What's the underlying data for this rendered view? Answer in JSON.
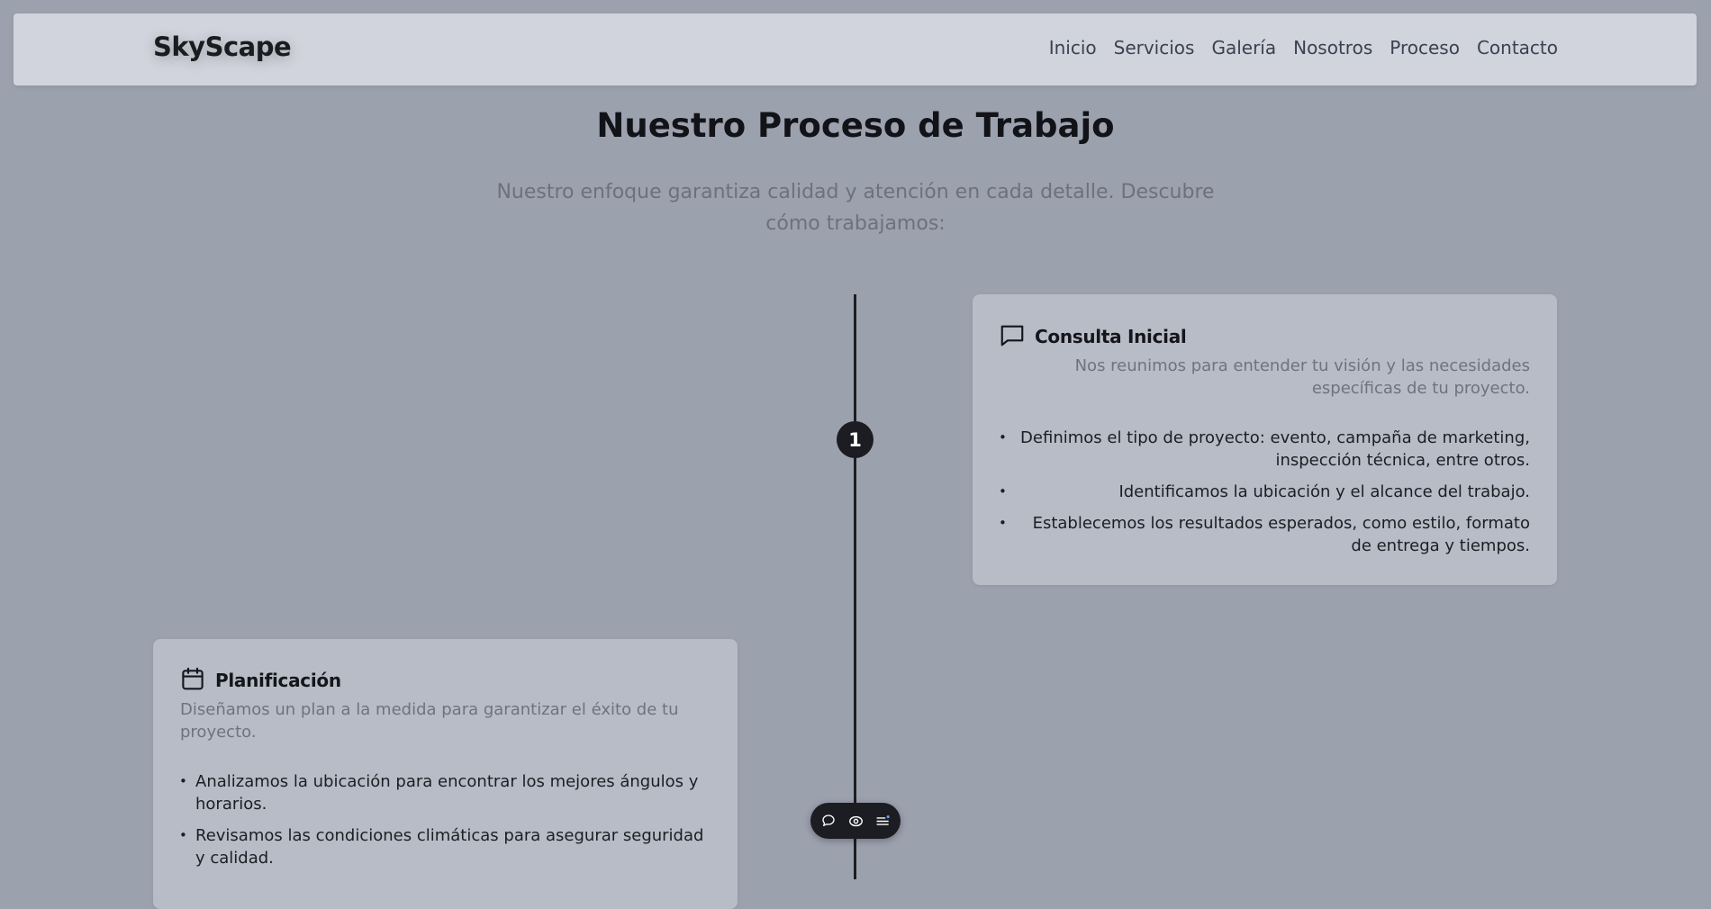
{
  "navbar": {
    "brand": "SkyScape",
    "links": [
      "Inicio",
      "Servicios",
      "Galería",
      "Nosotros",
      "Proceso",
      "Contacto"
    ]
  },
  "header": {
    "title": "Nuestro Proceso de Trabajo",
    "subtitle": "Nuestro enfoque garantiza calidad y atención en cada detalle. Descubre cómo trabajamos:"
  },
  "timeline": {
    "steps": [
      {
        "number": "1",
        "icon": "chat-bubble-icon",
        "title": "Consulta Inicial",
        "description": "Nos reunimos para entender tu visión y las necesidades específicas de tu proyecto.",
        "items": [
          "Definimos el tipo de proyecto: evento, campaña de marketing, inspección técnica, entre otros.",
          "Identificamos la ubicación y el alcance del trabajo.",
          "Establecemos los resultados esperados, como estilo, formato de entrega y tiempos."
        ]
      },
      {
        "icon": "calendar-icon",
        "title": "Planificación",
        "description": "Diseñamos un plan a la medida para garantizar el éxito de tu proyecto.",
        "items": [
          "Analizamos la ubicación para encontrar los mejores ángulos y horarios.",
          "Revisamos las condiciones climáticas para asegurar seguridad y calidad."
        ]
      }
    ]
  },
  "toolbar": {
    "icons": [
      "comment-icon",
      "eye-icon",
      "menu-icon"
    ]
  },
  "colors": {
    "background": "#9ca1ae",
    "navbar": "#d1d4dc",
    "card": "#b8bcc6",
    "accent": "#1c1d22"
  }
}
